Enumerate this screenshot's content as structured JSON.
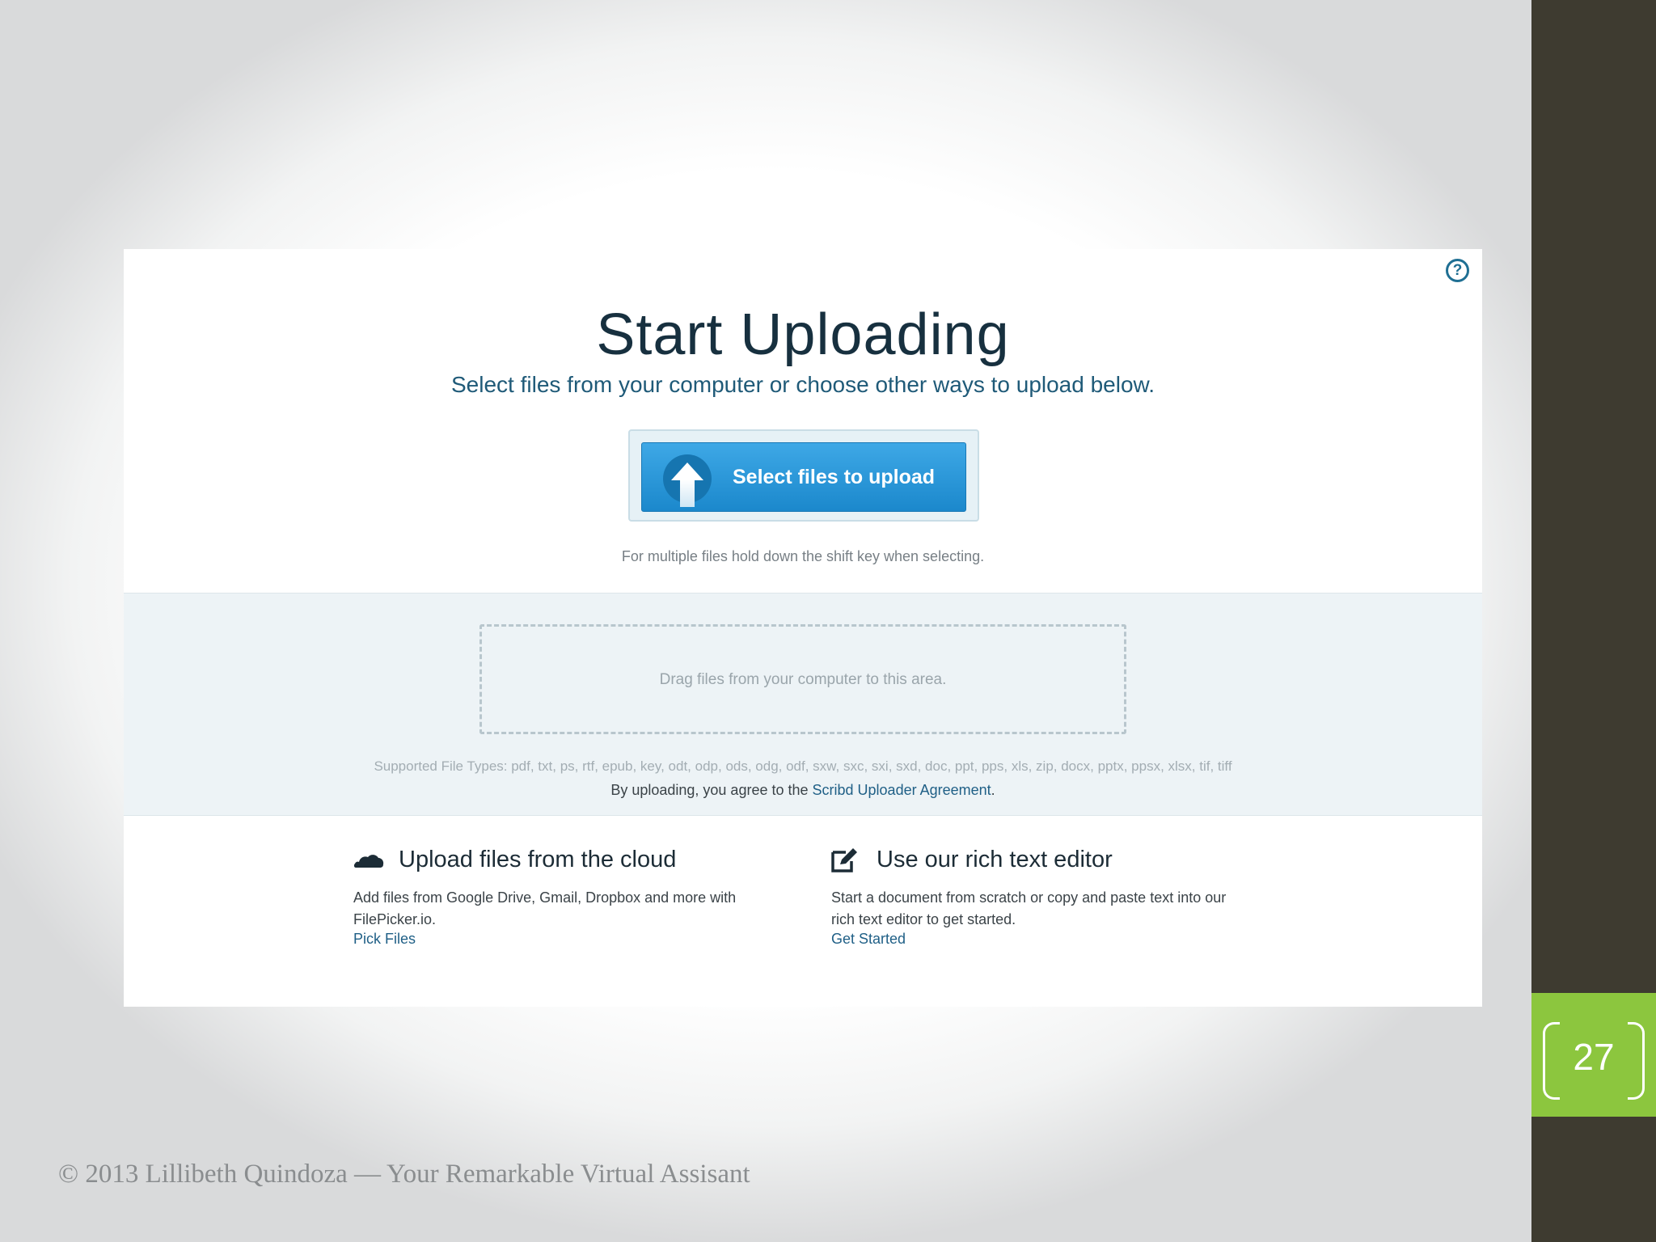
{
  "upload_page": {
    "help_icon_glyph": "?",
    "title": "Start Uploading",
    "subtitle": "Select files from your computer or choose other ways to upload below.",
    "select_button_label": "Select files to upload",
    "multi_file_hint": "For multiple files hold down the shift key when selecting.",
    "drop_zone_text": "Drag files from your computer to this area.",
    "supported_types": "Supported File Types: pdf, txt, ps, rtf, epub, key, odt, odp, ods, odg, odf, sxw, sxc, sxi, sxd, doc, ppt, pps, xls, zip, docx, pptx, ppsx, xlsx, tif, tiff",
    "agreement_prefix": "By uploading, you agree to the ",
    "agreement_link": "Scribd Uploader Agreement",
    "agreement_suffix": ".",
    "cloud_option": {
      "icon": "cloud-icon",
      "title": "Upload files from the cloud",
      "description": "Add files from Google Drive, Gmail, Dropbox and more with FilePicker.io.",
      "link": "Pick Files"
    },
    "editor_option": {
      "icon": "edit-icon",
      "title": "Use our rich text editor",
      "description": "Start a document from scratch or copy and paste text into our rich text editor to get started.",
      "link": "Get Started"
    }
  },
  "slide": {
    "page_number": "27",
    "footer": "© 2013 Lillibeth Quindoza  — Your Remarkable Virtual Assisant",
    "colors": {
      "sidebar": "#3e3b30",
      "page_badge": "#8cc63e",
      "button": "#2a9ad9",
      "link": "#1f5f86"
    }
  }
}
